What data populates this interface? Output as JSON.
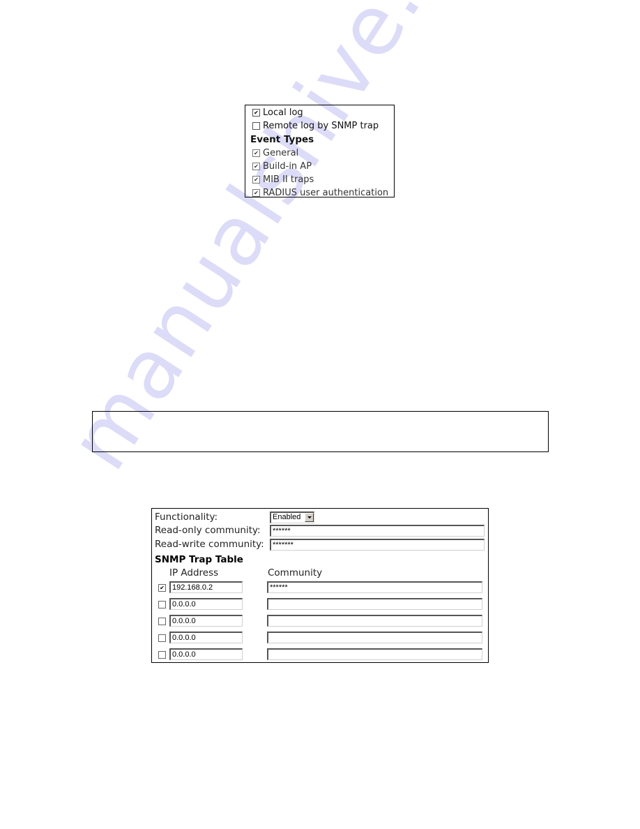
{
  "watermark": "manualshive.com",
  "log_panel": {
    "options": [
      {
        "label": "Local log",
        "checked": true
      },
      {
        "label": "Remote log by SNMP trap",
        "checked": false
      }
    ],
    "event_types_heading": "Event Types",
    "event_types": [
      {
        "label": "General",
        "checked": true,
        "disabled": true
      },
      {
        "label": "Build-in AP",
        "checked": true,
        "disabled": true
      },
      {
        "label": "MIB II traps",
        "checked": true,
        "disabled": true
      },
      {
        "label": "RADIUS user authentication",
        "checked": true,
        "disabled": true
      }
    ]
  },
  "snmp": {
    "functionality_label": "Functionality:",
    "functionality_value": "Enabled",
    "read_only_label": "Read-only community:",
    "read_only_value": "******",
    "read_write_label": "Read-write community:",
    "read_write_value": "*******",
    "trap_table_heading": "SNMP Trap Table",
    "ip_header": "IP Address",
    "community_header": "Community",
    "traps": [
      {
        "enabled": true,
        "ip": "192.168.0.2",
        "community": "******"
      },
      {
        "enabled": false,
        "ip": "0.0.0.0",
        "community": ""
      },
      {
        "enabled": false,
        "ip": "0.0.0.0",
        "community": ""
      },
      {
        "enabled": false,
        "ip": "0.0.0.0",
        "community": ""
      },
      {
        "enabled": false,
        "ip": "0.0.0.0",
        "community": ""
      }
    ]
  }
}
